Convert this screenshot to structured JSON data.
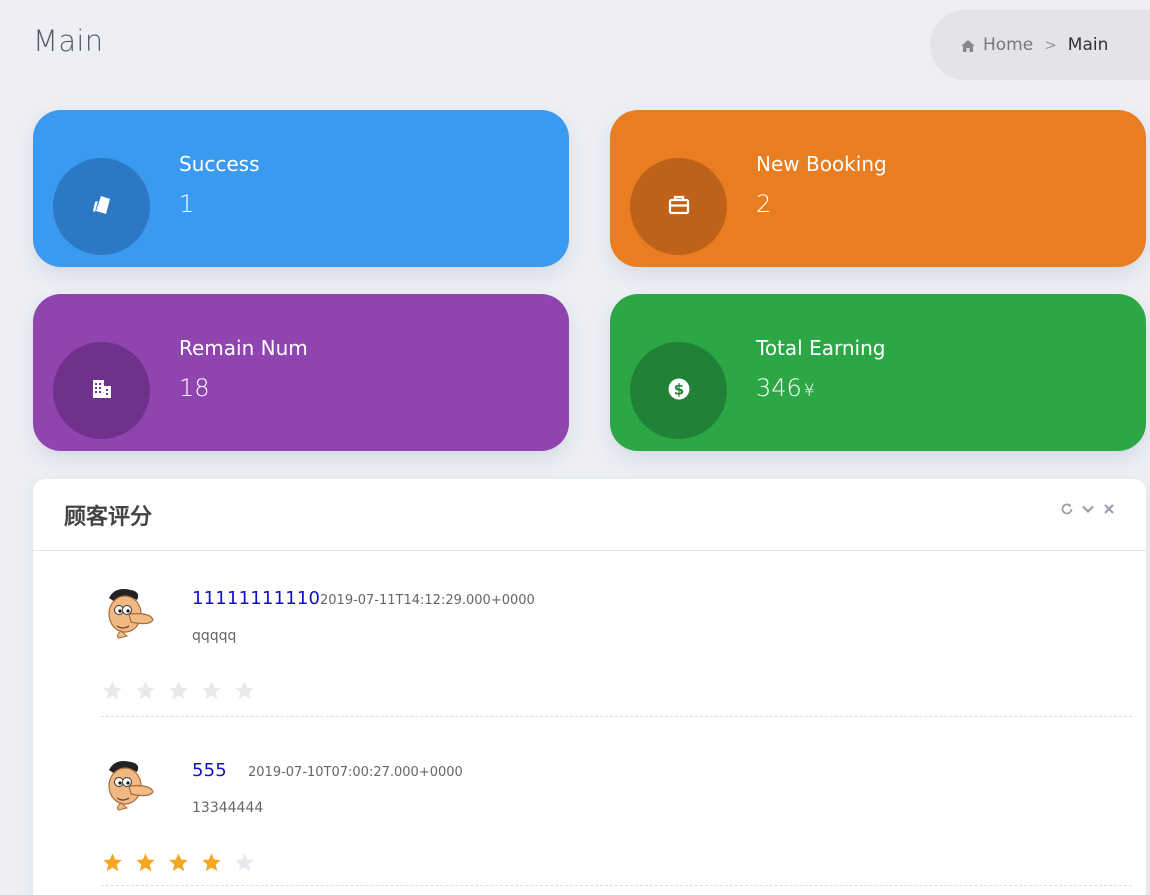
{
  "header": {
    "title": "Main",
    "breadcrumb": {
      "home_label": "Home",
      "current_label": "Main"
    }
  },
  "cards": [
    {
      "label": "Success",
      "value": "1",
      "unit": "",
      "icon": "ticket-icon",
      "color": "#3a9af0"
    },
    {
      "label": "New Booking",
      "value": "2",
      "unit": "",
      "icon": "briefcase-icon",
      "color": "#e87d22"
    },
    {
      "label": "Remain Num",
      "value": "18",
      "unit": "",
      "icon": "building-icon",
      "color": "#8f44b0"
    },
    {
      "label": "Total Earning",
      "value": "346",
      "unit": "¥",
      "icon": "dollar-circle-icon",
      "color": "#2ba845"
    }
  ],
  "reviews_panel": {
    "title": "顾客评分",
    "reviews": [
      {
        "name": "11111111110",
        "time": "2019-07-11T14:12:29.000+0000",
        "comment": "qqqqq",
        "rating": 0,
        "max_rating": 5
      },
      {
        "name": "555",
        "time": "2019-07-10T07:00:27.000+0000",
        "comment": "13344444",
        "rating": 4,
        "max_rating": 5
      }
    ]
  },
  "colors": {
    "star_on": "#f5a623",
    "star_off": "#e8e9ee",
    "name_link": "#1111cc"
  }
}
